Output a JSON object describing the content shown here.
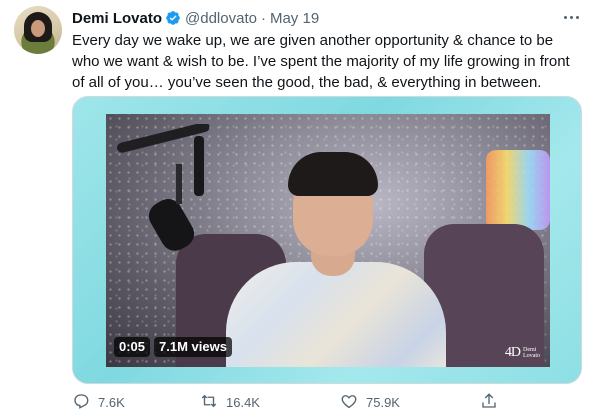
{
  "tweet": {
    "author": {
      "name": "Demi Lovato",
      "handle": "@ddlovato",
      "verified": true,
      "avatar_icon": "profile-photo"
    },
    "separator": "·",
    "date": "May 19",
    "more_icon": "more-horizontal-icon",
    "text": "Every day we wake up, we are given another opportunity & chance to be who we want & wish to be. I’ve spent the majority of my life growing in front of all of you… you’ve seen the good, the bad, & everything in between.",
    "media": {
      "type": "video",
      "duration": "0:05",
      "views": "7.1M views",
      "watermark_logo": "4D",
      "watermark_text_1": "Demi",
      "watermark_text_2": "Lovato",
      "frame_color": "#8fdfe5"
    },
    "actions": {
      "reply": {
        "icon": "reply-icon",
        "count": "7.6K"
      },
      "retweet": {
        "icon": "retweet-icon",
        "count": "16.4K"
      },
      "like": {
        "icon": "heart-icon",
        "count": "75.9K"
      },
      "share": {
        "icon": "share-icon"
      }
    },
    "colors": {
      "text": "#0f1419",
      "secondary": "#536471",
      "verified": "#1d9bf0"
    }
  }
}
